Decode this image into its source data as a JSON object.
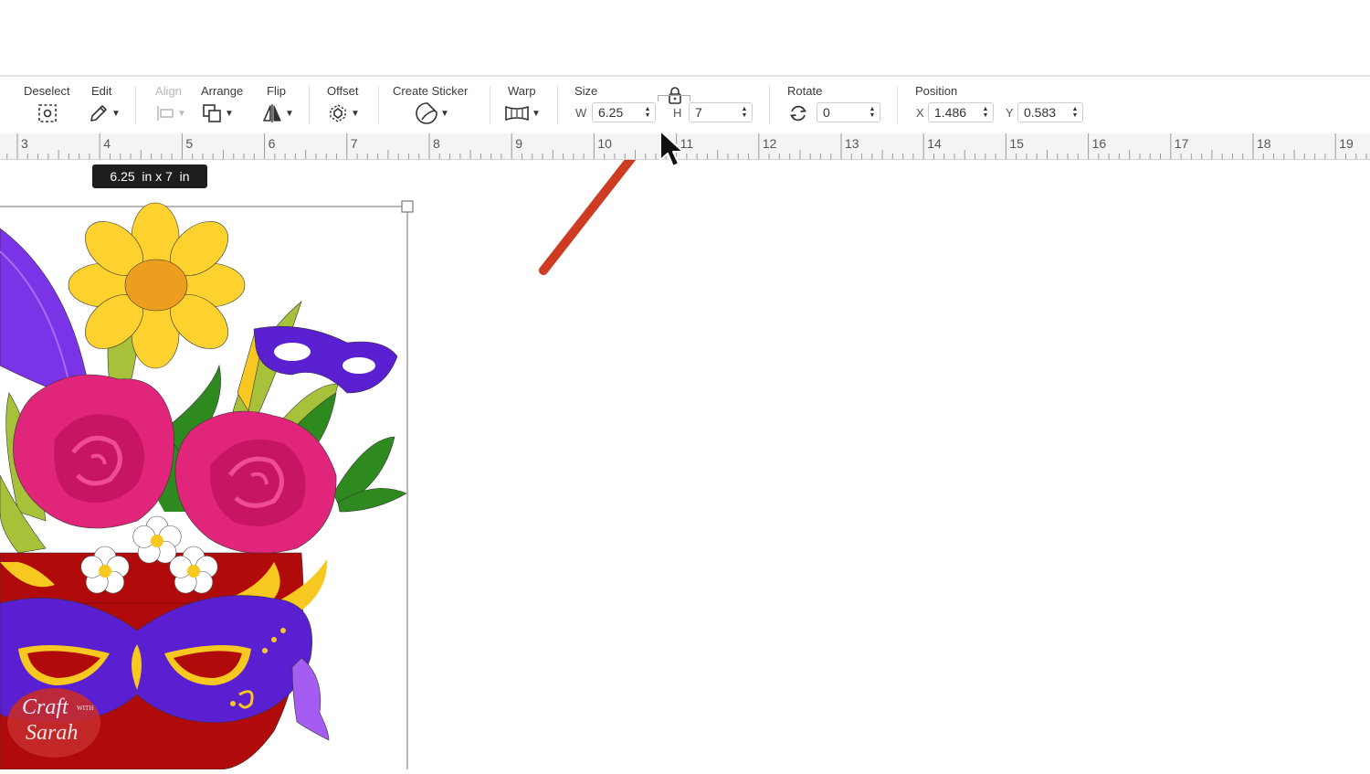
{
  "toolbar": {
    "deselect_label": "Deselect",
    "edit_label": "Edit",
    "align_label": "Align",
    "arrange_label": "Arrange",
    "flip_label": "Flip",
    "offset_label": "Offset",
    "create_sticker_label": "Create Sticker",
    "warp_label": "Warp",
    "size_label": "Size",
    "width_axis": "W",
    "width_value": "6.25",
    "height_axis": "H",
    "height_value": "7",
    "rotate_label": "Rotate",
    "rotate_value": "0",
    "position_label": "Position",
    "x_axis": "X",
    "x_value": "1.486",
    "y_axis": "Y",
    "y_value": "0.583"
  },
  "ruler": {
    "labels": [
      "3",
      "4",
      "5",
      "6",
      "7",
      "8",
      "9",
      "10",
      "11",
      "12",
      "13",
      "14",
      "15",
      "16",
      "17",
      "18",
      "19"
    ]
  },
  "canvas": {
    "size_tooltip": "6.25  in x 7  in",
    "watermark_line1": "Craft",
    "watermark_with": "WITH",
    "watermark_line2": "Sarah"
  },
  "colors": {
    "accent_arrow": "#cc3b22",
    "selection_border": "#8a8a8a",
    "mask_purple": "#5a1fd0",
    "rose_pink": "#e0257a",
    "pot_red": "#b10a0a",
    "daisy_yellow": "#fdd22e"
  },
  "icons": {
    "deselect": "deselect-icon",
    "edit": "pencil-icon",
    "align": "align-icon",
    "arrange": "arrange-icon",
    "flip": "flip-icon",
    "offset": "offset-icon",
    "sticker": "sticker-icon",
    "warp": "warp-icon",
    "lock": "lock-icon",
    "rotate": "rotate-icon",
    "cursor": "mouse-cursor-icon",
    "arrow": "annotation-arrow-icon"
  }
}
